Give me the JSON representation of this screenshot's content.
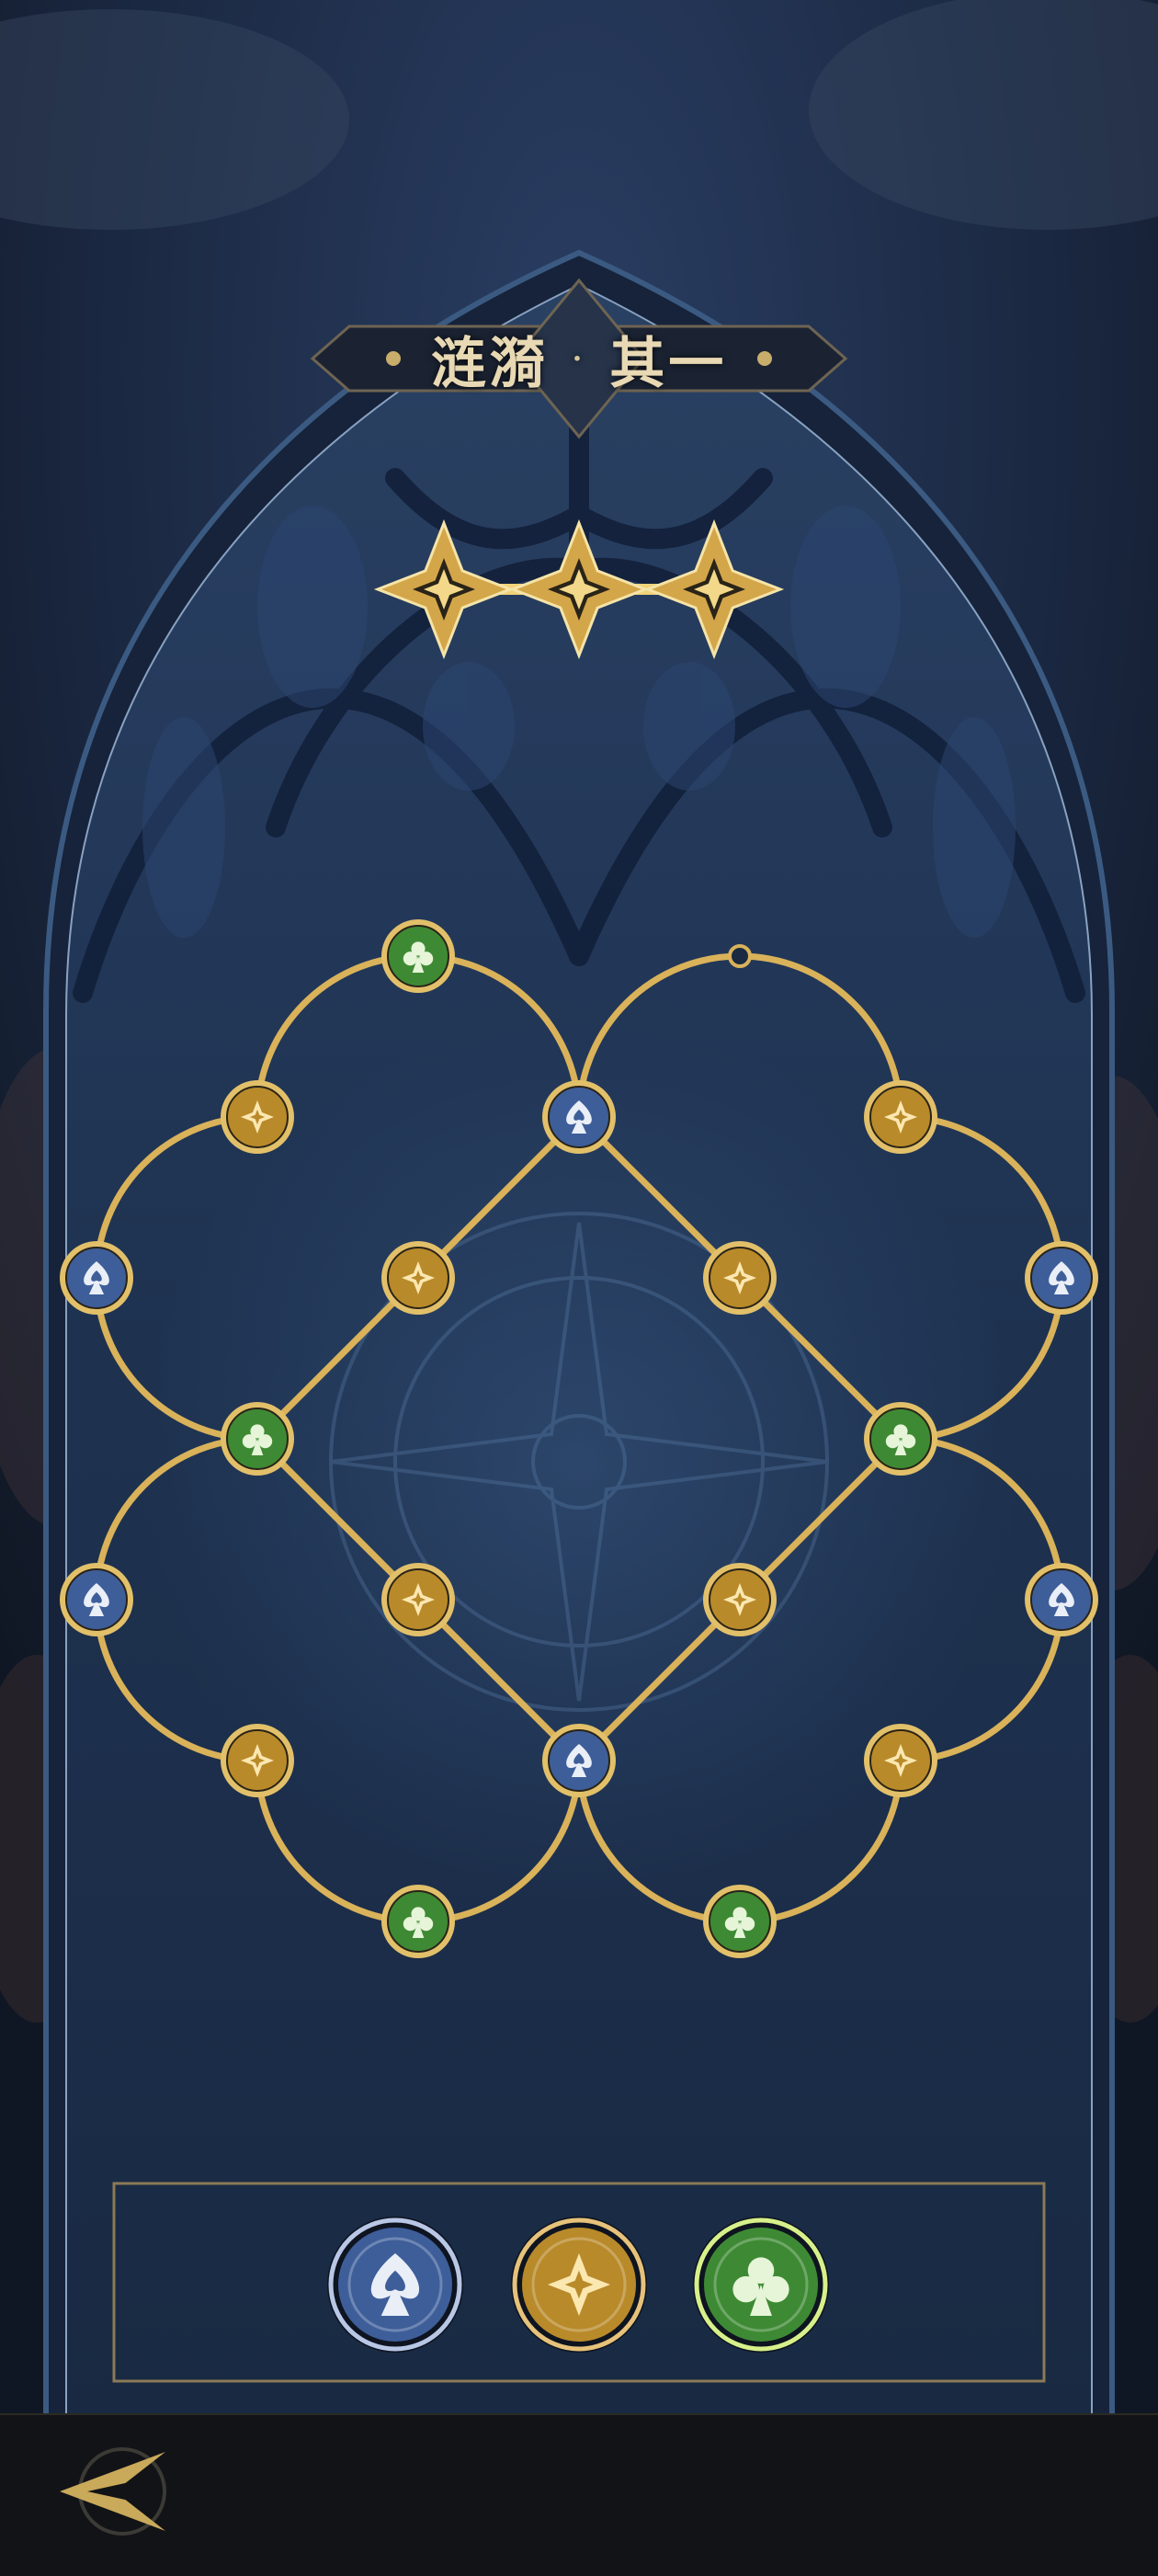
{
  "title": {
    "left": "涟漪",
    "separator": "·",
    "right": "其一"
  },
  "progress": {
    "stars_total": 3,
    "stars_lit": 3
  },
  "colors": {
    "gold": "#d9b25a",
    "spade": "#3e5e9a",
    "diamond": "#b98a2a",
    "club": "#3e8a34",
    "panel": "#1d2f49"
  },
  "board": {
    "nodes": [
      {
        "id": "n1",
        "suit": "club"
      },
      {
        "id": "n2",
        "suit": "diamond"
      },
      {
        "id": "n3",
        "suit": "spade"
      },
      {
        "id": "n4",
        "suit": "diamond"
      },
      {
        "id": "n5",
        "suit": "spade"
      },
      {
        "id": "n6",
        "suit": "diamond"
      },
      {
        "id": "n7",
        "suit": "diamond"
      },
      {
        "id": "n8",
        "suit": "spade"
      },
      {
        "id": "n9",
        "suit": "club"
      },
      {
        "id": "n10",
        "suit": "club"
      },
      {
        "id": "n11",
        "suit": "spade"
      },
      {
        "id": "n12",
        "suit": "diamond"
      },
      {
        "id": "n13",
        "suit": "diamond"
      },
      {
        "id": "n14",
        "suit": "spade"
      },
      {
        "id": "n15",
        "suit": "diamond"
      },
      {
        "id": "n16",
        "suit": "spade"
      },
      {
        "id": "n17",
        "suit": "diamond"
      },
      {
        "id": "n18",
        "suit": "club"
      },
      {
        "id": "n19",
        "suit": "club"
      }
    ],
    "empty_socket": true
  },
  "tray": {
    "pieces": [
      "spade",
      "diamond",
      "club"
    ]
  },
  "icons": {
    "back": "back-arrow-icon",
    "star": "four-point-star-icon"
  }
}
